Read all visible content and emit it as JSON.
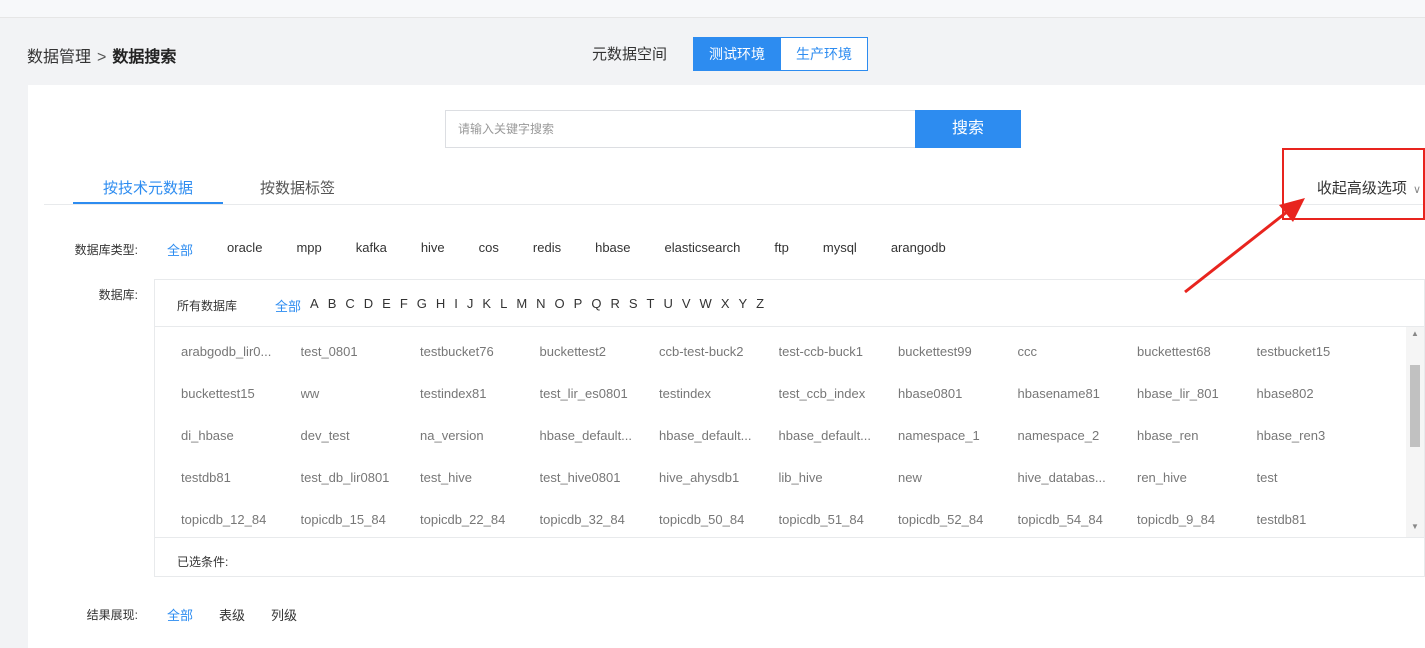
{
  "breadcrumb": {
    "parent": "数据管理",
    "separator": ">",
    "current": "数据搜索"
  },
  "env": {
    "label": "元数据空间",
    "options": [
      "测试环境",
      "生产环境"
    ],
    "selected": "测试环境"
  },
  "search": {
    "placeholder": "请输入关键字搜索",
    "value": "",
    "button": "搜索"
  },
  "tabs": [
    "按技术元数据",
    "按数据标签"
  ],
  "active_tab": "按技术元数据",
  "collapse_label": "收起高级选项",
  "db_type": {
    "label": "数据库类型:",
    "options": [
      "全部",
      "oracle",
      "mpp",
      "kafka",
      "hive",
      "cos",
      "redis",
      "hbase",
      "elasticsearch",
      "ftp",
      "mysql",
      "arangodb"
    ],
    "selected": "全部"
  },
  "database": {
    "label": "数据库:",
    "all_label": "所有数据库",
    "letters": [
      "全部",
      "A",
      "B",
      "C",
      "D",
      "E",
      "F",
      "G",
      "H",
      "I",
      "J",
      "K",
      "L",
      "M",
      "N",
      "O",
      "P",
      "Q",
      "R",
      "S",
      "T",
      "U",
      "V",
      "W",
      "X",
      "Y",
      "Z"
    ],
    "selected_letter": "全部",
    "items": [
      "arabgodb_lir0...",
      "test_0801",
      "testbucket76",
      "buckettest2",
      "ccb-test-buck2",
      "test-ccb-buck1",
      "buckettest99",
      "ccc",
      "buckettest68",
      "testbucket15",
      "buckettest15",
      "ww",
      "testindex81",
      "test_lir_es0801",
      "testindex",
      "test_ccb_index",
      "hbase0801",
      "hbasename81",
      "hbase_lir_801",
      "hbase802",
      "di_hbase",
      "dev_test",
      "na_version",
      "hbase_default...",
      "hbase_default...",
      "hbase_default...",
      "namespace_1",
      "namespace_2",
      "hbase_ren",
      "hbase_ren3",
      "testdb81",
      "test_db_lir0801",
      "test_hive",
      "test_hive0801",
      "hive_ahysdb1",
      "lib_hive",
      "new",
      "hive_databas...",
      "ren_hive",
      "test",
      "topicdb_12_84",
      "topicdb_15_84",
      "topicdb_22_84",
      "topicdb_32_84",
      "topicdb_50_84",
      "topicdb_51_84",
      "topicdb_52_84",
      "topicdb_54_84",
      "topicdb_9_84",
      "testdb81"
    ],
    "selected_conditions_label": "已选条件:"
  },
  "result_display": {
    "label": "结果展现:",
    "options": [
      "全部",
      "表级",
      "列级"
    ],
    "selected": "全部"
  },
  "colors": {
    "accent": "#2d8cf0",
    "annotation": "#e8241e"
  }
}
